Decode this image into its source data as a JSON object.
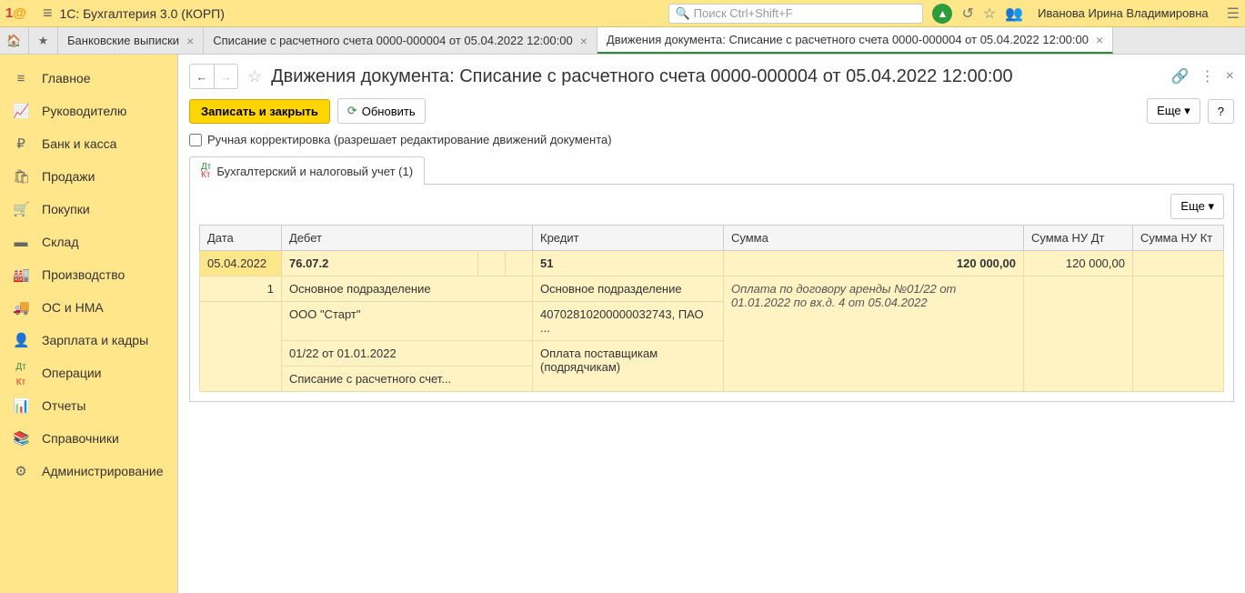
{
  "header": {
    "app_title": "1С: Бухгалтерия 3.0 (КОРП)",
    "search_placeholder": "Поиск Ctrl+Shift+F",
    "user_name": "Иванова Ирина Владимировна"
  },
  "tabs": [
    {
      "label": "Банковские выписки"
    },
    {
      "label": "Списание с расчетного счета 0000-000004 от 05.04.2022 12:00:00"
    },
    {
      "label": "Движения документа: Списание с расчетного счета 0000-000004 от 05.04.2022 12:00:00"
    }
  ],
  "sidebar": {
    "items": [
      {
        "icon": "≡",
        "label": "Главное"
      },
      {
        "icon": "📈",
        "label": "Руководителю"
      },
      {
        "icon": "₽",
        "label": "Банк и касса"
      },
      {
        "icon": "🛍",
        "label": "Продажи"
      },
      {
        "icon": "🛒",
        "label": "Покупки"
      },
      {
        "icon": "▬",
        "label": "Склад"
      },
      {
        "icon": "🏭",
        "label": "Производство"
      },
      {
        "icon": "🚚",
        "label": "ОС и НМА"
      },
      {
        "icon": "👤",
        "label": "Зарплата и кадры"
      },
      {
        "icon": "Дт",
        "label": "Операции"
      },
      {
        "icon": "📊",
        "label": "Отчеты"
      },
      {
        "icon": "📚",
        "label": "Справочники"
      },
      {
        "icon": "⚙",
        "label": "Администрирование"
      }
    ]
  },
  "page": {
    "title": "Движения документа: Списание с расчетного счета 0000-000004 от 05.04.2022 12:00:00",
    "btn_save_close": "Записать и закрыть",
    "btn_refresh": "Обновить",
    "btn_more": "Еще",
    "btn_help": "?",
    "checkbox_label": "Ручная корректировка (разрешает редактирование движений документа)",
    "panel_tab": "Бухгалтерский и налоговый учет (1)"
  },
  "table": {
    "headers": {
      "date": "Дата",
      "debit": "Дебет",
      "credit": "Кредит",
      "sum": "Сумма",
      "sum_nu_dt": "Сумма НУ Дт",
      "sum_nu_kt": "Сумма НУ Кт"
    },
    "row": {
      "date": "05.04.2022",
      "num": "1",
      "debit_account": "76.07.2",
      "credit_account": "51",
      "sum": "120 000,00",
      "sum_nu_dt": "120 000,00",
      "debit_sub1": "Основное подразделение",
      "debit_sub2": "ООО \"Старт\"",
      "debit_sub3": "01/22 от 01.01.2022",
      "debit_sub4": "Списание с расчетного счет...",
      "credit_sub1": "Основное подразделение",
      "credit_sub2": "40702810200000032743, ПАО ...",
      "credit_sub3": "Оплата поставщикам (подрядчикам)",
      "description": "Оплата по договору аренды №01/22 от 01.01.2022 по вх.д. 4 от 05.04.2022"
    }
  }
}
